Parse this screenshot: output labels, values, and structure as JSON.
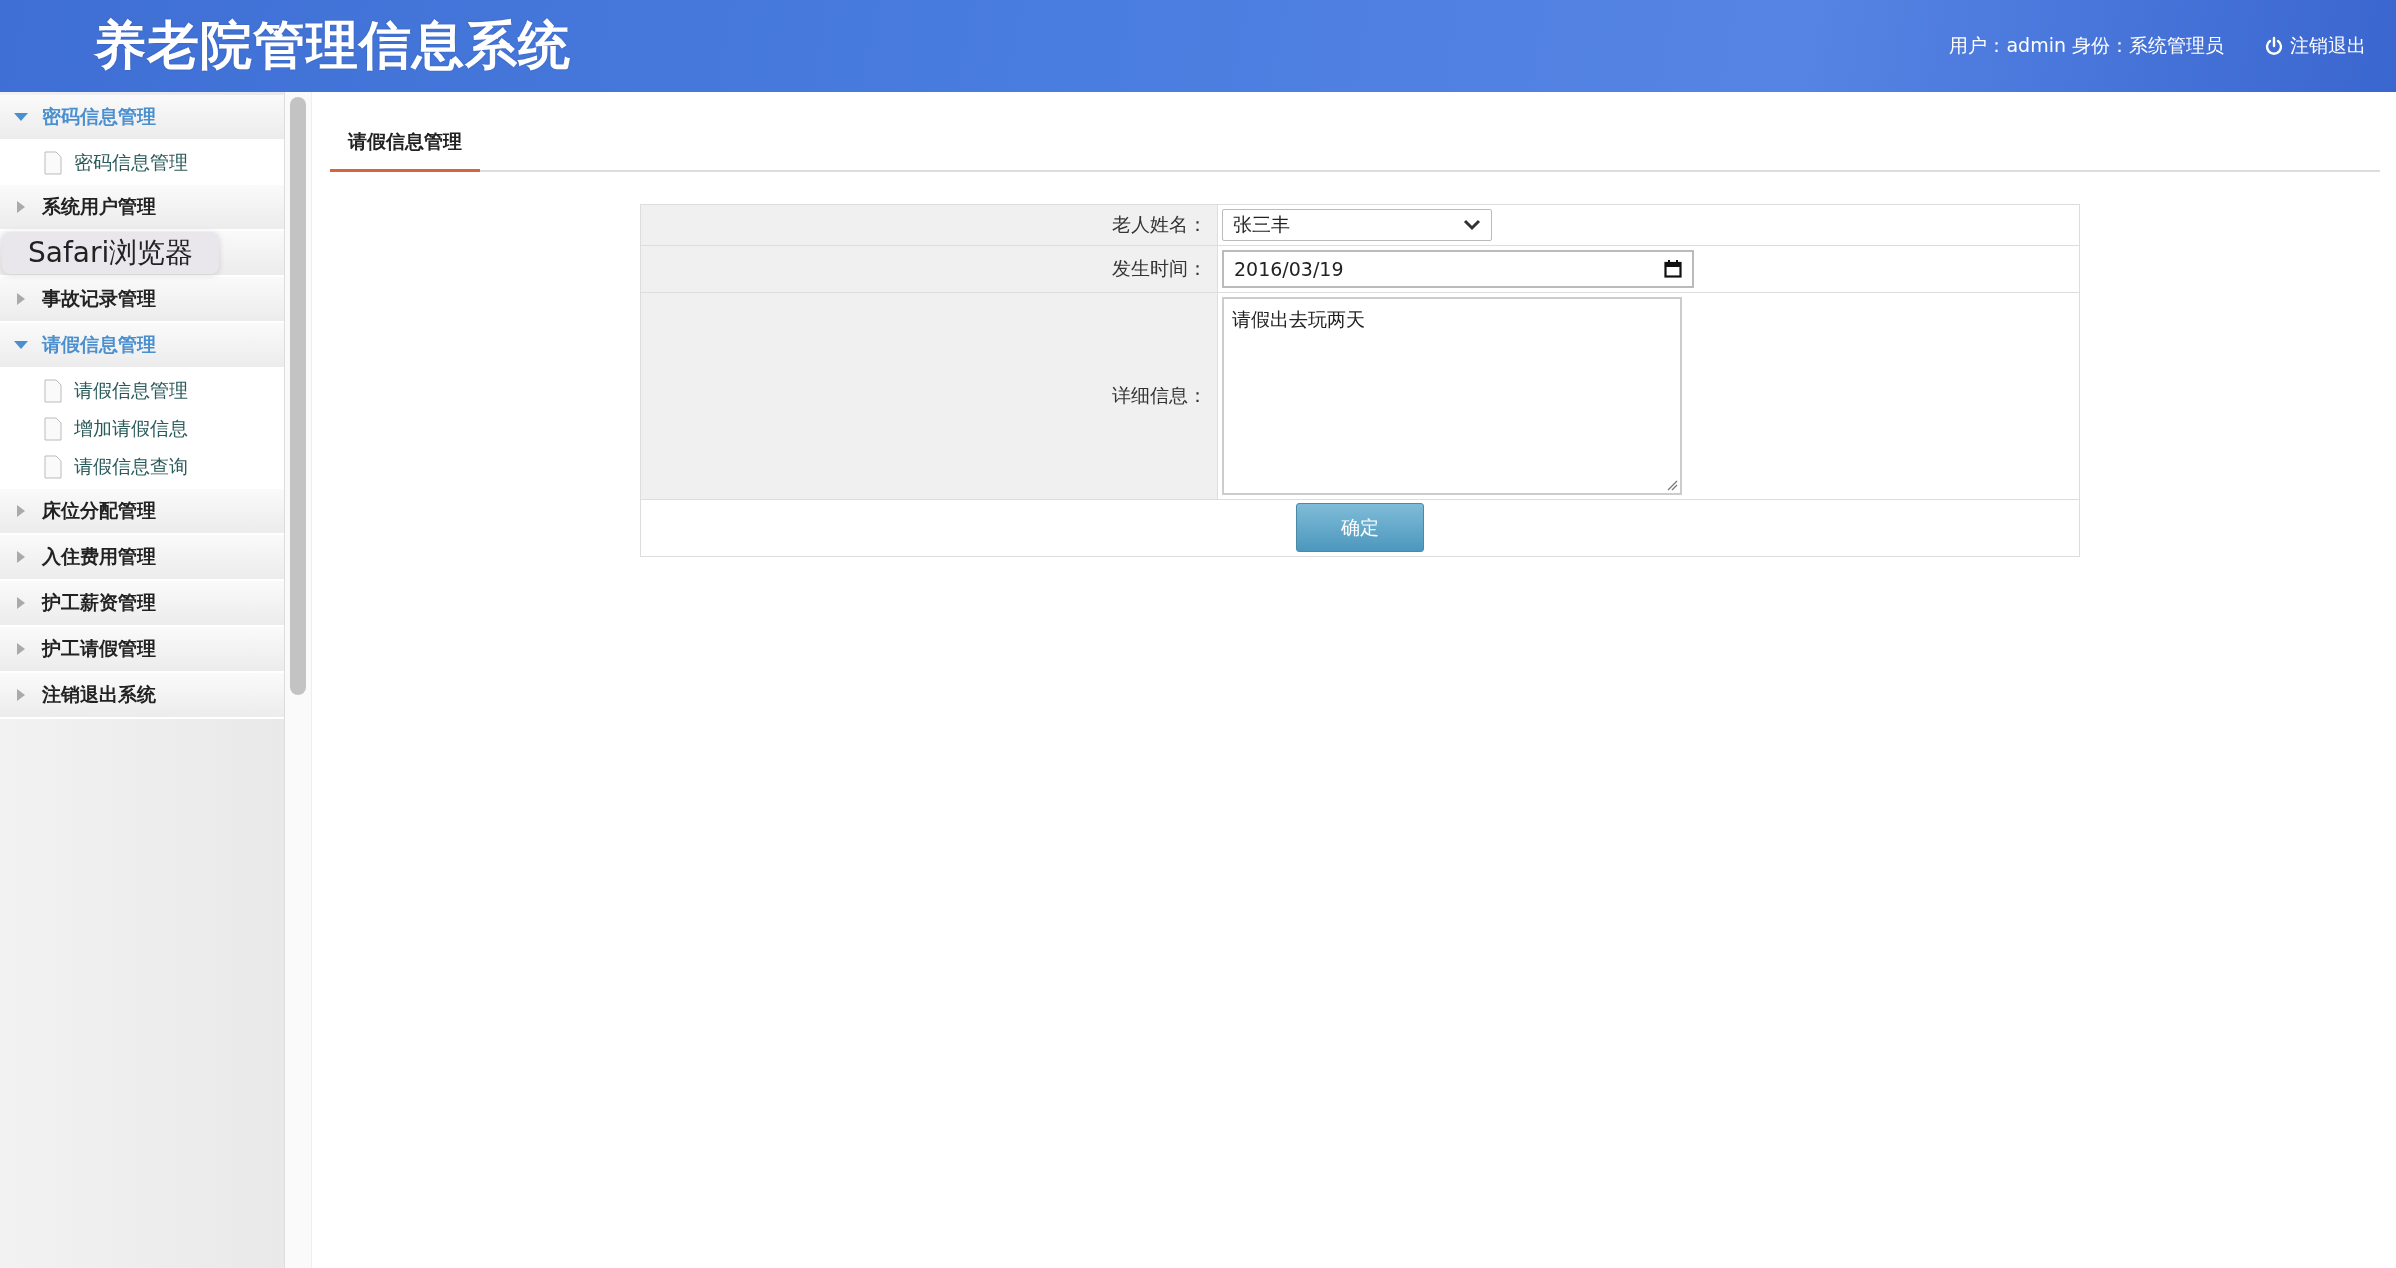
{
  "header": {
    "title": "养老院管理信息系统",
    "user_info": "用户：admin 身份：系统管理员",
    "logout": "注销退出"
  },
  "sidebar": {
    "groups": [
      {
        "kind": "group",
        "label": "密码信息管理",
        "expanded": true,
        "children": [
          {
            "label": "密码信息管理"
          }
        ]
      },
      {
        "kind": "group",
        "label": "系统用户管理",
        "expanded": false
      },
      {
        "kind": "covered"
      },
      {
        "kind": "group",
        "label": "事故记录管理",
        "expanded": false
      },
      {
        "kind": "group",
        "label": "请假信息管理",
        "expanded": true,
        "children": [
          {
            "label": "请假信息管理"
          },
          {
            "label": "增加请假信息"
          },
          {
            "label": "请假信息查询"
          }
        ]
      },
      {
        "kind": "group",
        "label": "床位分配管理",
        "expanded": false
      },
      {
        "kind": "group",
        "label": "入住费用管理",
        "expanded": false
      },
      {
        "kind": "group",
        "label": "护工薪资管理",
        "expanded": false
      },
      {
        "kind": "group",
        "label": "护工请假管理",
        "expanded": false
      },
      {
        "kind": "group",
        "label": "注销退出系统",
        "expanded": false
      }
    ]
  },
  "tooltip": "Safari浏览器",
  "tabs": [
    {
      "label": "请假信息管理",
      "selected": true
    }
  ],
  "form": {
    "fields": [
      {
        "kind": "select",
        "label": "老人姓名：",
        "value": "张三丰"
      },
      {
        "kind": "date",
        "label": "发生时间：",
        "value": "2016/03/19"
      },
      {
        "kind": "textarea",
        "label": "详细信息：",
        "value": "请假出去玩两天"
      }
    ],
    "submit": "确定"
  }
}
